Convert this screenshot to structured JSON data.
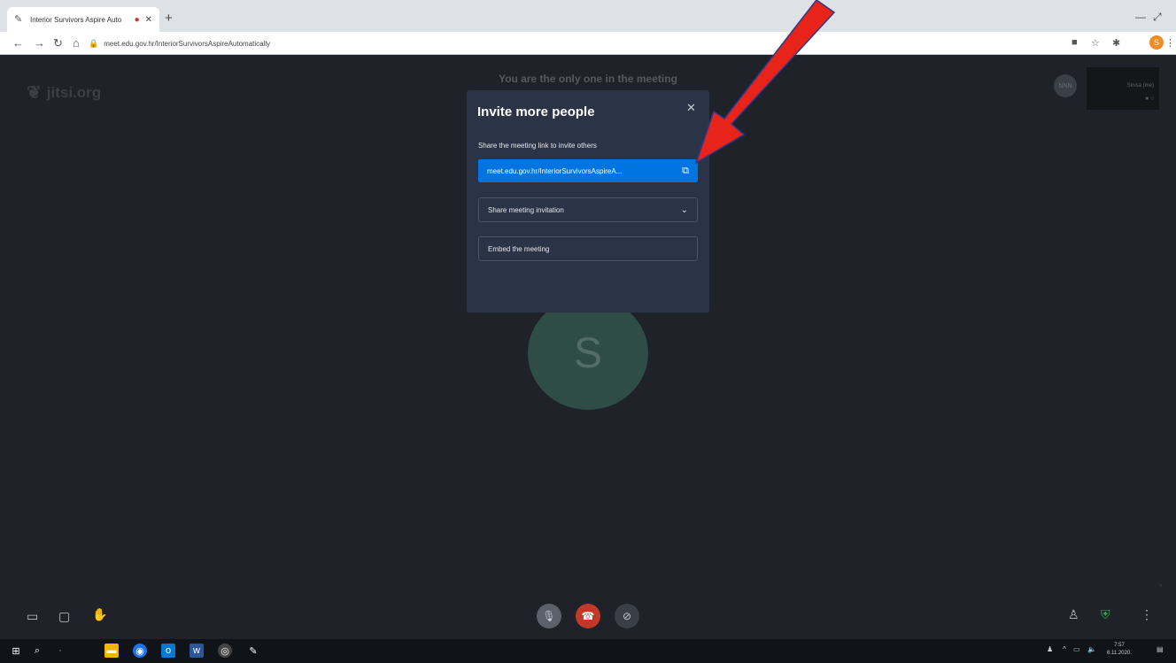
{
  "browser": {
    "tab_title": "Interior Survivors Aspire Auto",
    "tab_favicon": "feather-icon",
    "url": "meet.edu.gov.hr/InteriorSurvivorsAspireAutomatically"
  },
  "meeting": {
    "logo_text": "jitsi.org",
    "status_text": "You are the only one in the meeting",
    "avatar_letter": "S",
    "mini_avatar_text": "NNN",
    "filmstrip_name": "Sinisa (me)"
  },
  "dialog": {
    "title": "Invite more people",
    "share_label": "Share the meeting link to invite others",
    "link_text": "meet.edu.gov.hr/InteriorSurvivorsAspireA...",
    "share_invitation_label": "Share meeting invitation",
    "embed_label": "Embed the meeting"
  },
  "taskbar": {
    "clock_time": "7:57",
    "clock_date": "6.11.2020."
  },
  "colors": {
    "dialog_bg": "#2a3446",
    "link_bg": "#0074e0",
    "hangup": "#c0392b",
    "arrow": "#e8231a"
  }
}
